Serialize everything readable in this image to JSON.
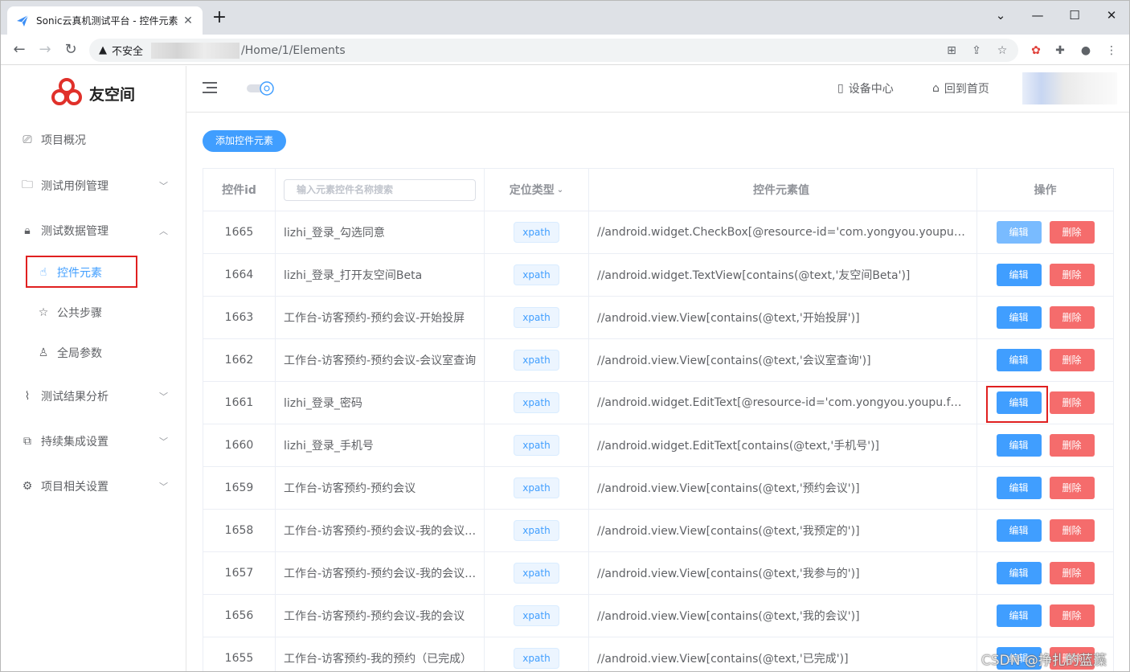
{
  "browser": {
    "tab_title": "Sonic云真机测试平台 - 控件元素",
    "new_tab": "+",
    "insecure_label": "不安全",
    "url_path": "/Home/1/Elements"
  },
  "sidebar": {
    "logo_text": "友空间",
    "items": [
      {
        "label": "项目概况",
        "icon": "presentation-board-icon"
      },
      {
        "label": "测试用例管理",
        "icon": "folder-icon"
      },
      {
        "label": "测试数据管理",
        "icon": "lock-icon"
      },
      {
        "label": "测试结果分析",
        "icon": "paperclip-icon"
      },
      {
        "label": "持续集成设置",
        "icon": "link-icon"
      },
      {
        "label": "项目相关设置",
        "icon": "gear-icon"
      }
    ],
    "subitems": [
      {
        "label": "控件元素",
        "icon": "pointer-hand-icon",
        "active": true
      },
      {
        "label": "公共步骤",
        "icon": "star-icon"
      },
      {
        "label": "全局参数",
        "icon": "user-icon"
      }
    ]
  },
  "header": {
    "device_center": "设备中心",
    "home": "回到首页"
  },
  "main": {
    "add_button": "添加控件元素",
    "columns": {
      "id": "控件id",
      "search_placeholder": "输入元素控件名称搜索",
      "type": "定位类型",
      "value": "控件元素值",
      "ops": "操作"
    },
    "edit_label": "编辑",
    "delete_label": "删除",
    "rows": [
      {
        "id": "1665",
        "name": "lizhi_登录_勾选同意",
        "type": "xpath",
        "value": "//android.widget.CheckBox[@resource-id='com.yongyou.youpu.formal:id/agree']"
      },
      {
        "id": "1664",
        "name": "lizhi_登录_打开友空间Beta",
        "type": "xpath",
        "value": "//android.widget.TextView[contains(@text,'友空间Beta')]"
      },
      {
        "id": "1663",
        "name": "工作台-访客预约-预约会议-开始投屏",
        "type": "xpath",
        "value": "//android.view.View[contains(@text,'开始投屏')]"
      },
      {
        "id": "1662",
        "name": "工作台-访客预约-预约会议-会议室查询",
        "type": "xpath",
        "value": "//android.view.View[contains(@text,'会议室查询')]"
      },
      {
        "id": "1661",
        "name": "lizhi_登录_密码",
        "type": "xpath",
        "value": "//android.widget.EditText[@resource-id='com.yongyou.youpu.formal:id/password']"
      },
      {
        "id": "1660",
        "name": "lizhi_登录_手机号",
        "type": "xpath",
        "value": "//android.widget.EditText[contains(@text,'手机号')]"
      },
      {
        "id": "1659",
        "name": "工作台-访客预约-预约会议",
        "type": "xpath",
        "value": "//android.view.View[contains(@text,'预约会议')]"
      },
      {
        "id": "1658",
        "name": "工作台-访客预约-预约会议-我的会议-我预定的",
        "type": "xpath",
        "value": "//android.view.View[contains(@text,'我预定的')]"
      },
      {
        "id": "1657",
        "name": "工作台-访客预约-预约会议-我的会议-我参与的",
        "type": "xpath",
        "value": "//android.view.View[contains(@text,'我参与的')]"
      },
      {
        "id": "1656",
        "name": "工作台-访客预约-预约会议-我的会议",
        "type": "xpath",
        "value": "//android.view.View[contains(@text,'我的会议')]"
      },
      {
        "id": "1655",
        "name": "工作台-访客预约-我的预约（已完成）",
        "type": "xpath",
        "value": "//android.view.View[contains(@text,'已完成')]"
      }
    ]
  },
  "watermark": "CSDN @挣扎的蓝藻",
  "colors": {
    "primary": "#409eff",
    "danger": "#f56c6c",
    "highlight_box": "#e02020"
  }
}
